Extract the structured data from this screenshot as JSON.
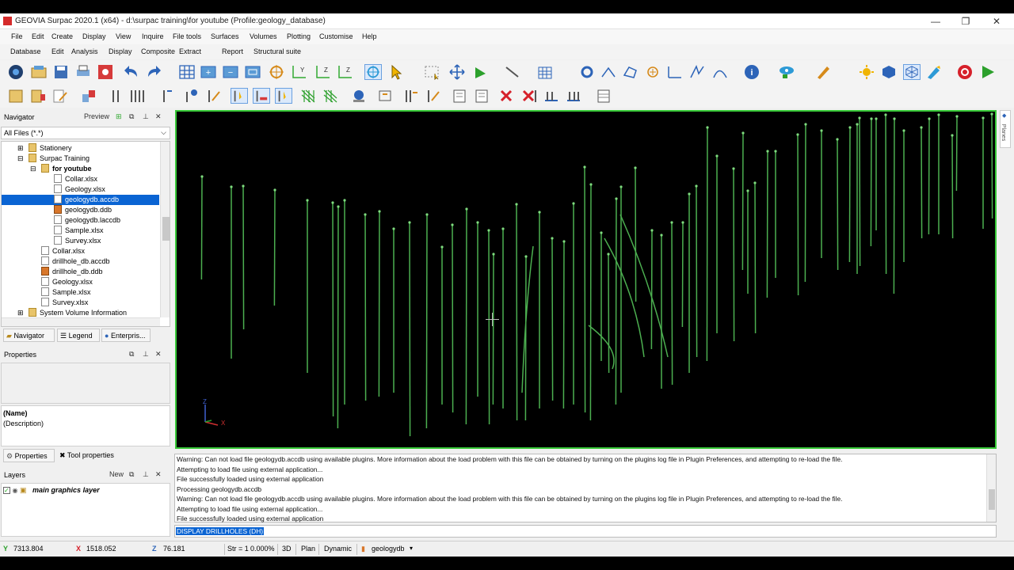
{
  "window": {
    "title": "GEOVIA Surpac 2020.1 (x64) - d:\\surpac training\\for youtube (Profile:geology_database)",
    "minimize": "—",
    "restore": "❐",
    "close": "✕"
  },
  "menu1": [
    "File",
    "Edit",
    "Create",
    "Display",
    "View",
    "Inquire",
    "File tools",
    "Surfaces",
    "Volumes",
    "Plotting",
    "Customise",
    "Help"
  ],
  "menu2": [
    "Database",
    "Edit",
    "Analysis",
    "Display",
    "Composite",
    "Extract",
    "Report",
    "Structural suite"
  ],
  "navigator": {
    "title": "Navigator",
    "preview": "Preview",
    "filter": "All Files (*.*)",
    "items": [
      {
        "label": "Stationery",
        "type": "folder"
      },
      {
        "label": "Surpac Training",
        "type": "folder"
      },
      {
        "label": "for youtube",
        "type": "folder"
      },
      {
        "label": "Collar.xlsx",
        "type": "xl"
      },
      {
        "label": "Geology.xlsx",
        "type": "xl"
      },
      {
        "label": "geologydb.accdb",
        "type": "file"
      },
      {
        "label": "geologydb.ddb",
        "type": "db"
      },
      {
        "label": "geologydb.laccdb",
        "type": "file"
      },
      {
        "label": "Sample.xlsx",
        "type": "xl"
      },
      {
        "label": "Survey.xlsx",
        "type": "xl"
      },
      {
        "label": "Collar.xlsx",
        "type": "xl"
      },
      {
        "label": "drillhole_db.accdb",
        "type": "file"
      },
      {
        "label": "drillhole_db.ddb",
        "type": "db"
      },
      {
        "label": "Geology.xlsx",
        "type": "xl"
      },
      {
        "label": "Sample.xlsx",
        "type": "xl"
      },
      {
        "label": "Survey.xlsx",
        "type": "xl"
      },
      {
        "label": "System Volume Information",
        "type": "folder"
      }
    ],
    "tabs": [
      "Navigator",
      "Legend",
      "Enterpris..."
    ]
  },
  "properties": {
    "title": "Properties",
    "name_label": "(Name)",
    "desc_label": "(Description)",
    "tabs": [
      "Properties",
      "Tool properties"
    ]
  },
  "layers": {
    "title": "Layers",
    "new": "New",
    "item": "main graphics layer"
  },
  "view": {
    "planes_tab": "Planes",
    "axis_z": "Z",
    "axis_x": "X"
  },
  "console": {
    "lines": [
      "Warning: Can not load file geologydb.accdb using available plugins.  More information about the load problem with this file can be obtained by turning on the plugins log file in Plugin Preferences, and attempting to re-load the file.",
      "Attempting to load file using external application...",
      "File successfully loaded using external application",
      "Processing geologydb.accdb",
      "Warning: Can not load file geologydb.accdb using available plugins.  More information about the load problem with this file can be obtained by turning on the plugins log file in Plugin Preferences, and attempting to re-load the file.",
      "Attempting to load file using external application...",
      "File successfully loaded using external application"
    ],
    "command": "DISPLAY DRILLHOLES (DH)"
  },
  "status": {
    "y_value": "7313.804",
    "x_value": "1518.052",
    "z_value": "76.181",
    "str_label": "Str = 1",
    "zoom": "0.000%",
    "mode3d": "3D",
    "plan": "Plan",
    "dynamic": "Dynamic",
    "db": "geologydb"
  },
  "colors": {
    "accent": "#0a64d3",
    "drillhole": "#4caf50",
    "viewport_border": "#38c938"
  }
}
